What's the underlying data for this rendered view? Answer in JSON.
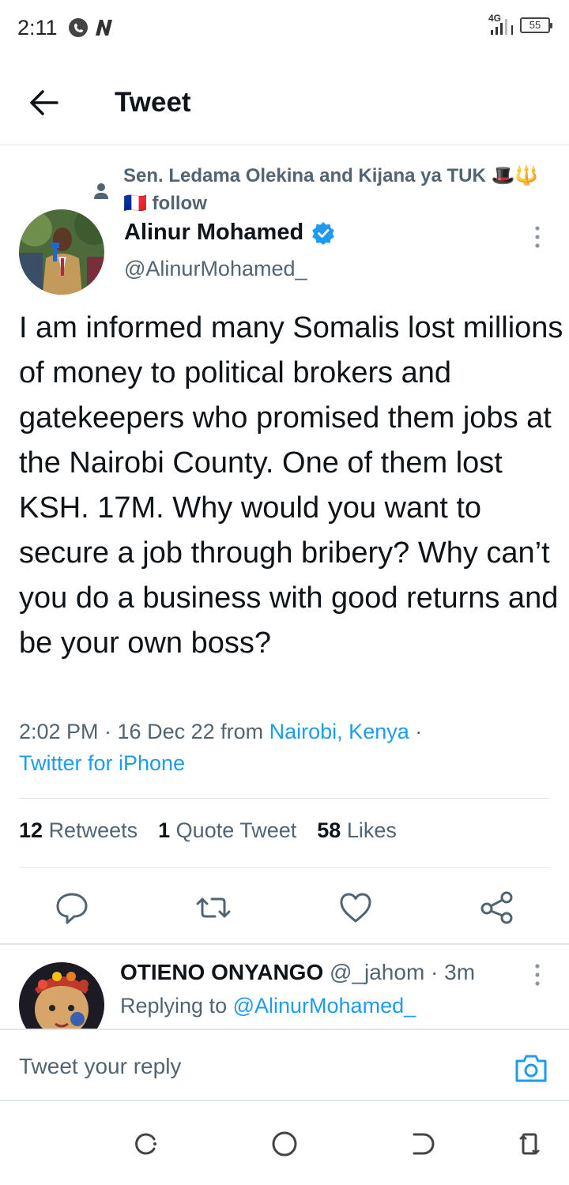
{
  "status_bar": {
    "time": "2:11",
    "network": "4G",
    "battery": "55"
  },
  "header": {
    "title": "Tweet"
  },
  "social_context": {
    "text": "Sen. Ledama Olekina and Kijana ya TUK 🎩🔱 🇫🇷 follow"
  },
  "tweet": {
    "author_name": "Alinur Mohamed",
    "author_handle": "@AlinurMohamed_",
    "text": "I am informed many Somalis lost millions of money to political brokers and gatekeepers who promised them jobs at the Nairobi County. One of them lost KSH. 17M. Why would you want to secure a job through bribery? Why can’t you do a business with good returns and be your own boss?",
    "time": "2:02 PM · 16 Dec 22 from ",
    "location": "Nairobi, Kenya",
    "sep": " · ",
    "source": "Twitter for iPhone"
  },
  "stats": {
    "retweets_count": "12",
    "retweets_label": "Retweets",
    "quotes_count": "1",
    "quotes_label": "Quote Tweet",
    "likes_count": "58",
    "likes_label": "Likes"
  },
  "actions": {
    "reply": "reply-icon",
    "retweet": "retweet-icon",
    "like": "heart-icon",
    "share": "share-icon"
  },
  "reply": {
    "name": "OTIENO ONYANGO",
    "handle": "@_jahom · 3m",
    "replying_prefix": "Replying to ",
    "replying_to": "@AlinurMohamed_"
  },
  "compose": {
    "placeholder": "Tweet your reply"
  },
  "colors": {
    "accent": "#1d9bf0",
    "text": "#0f1419",
    "secondary": "#536471",
    "divider": "#e1e6ea"
  }
}
